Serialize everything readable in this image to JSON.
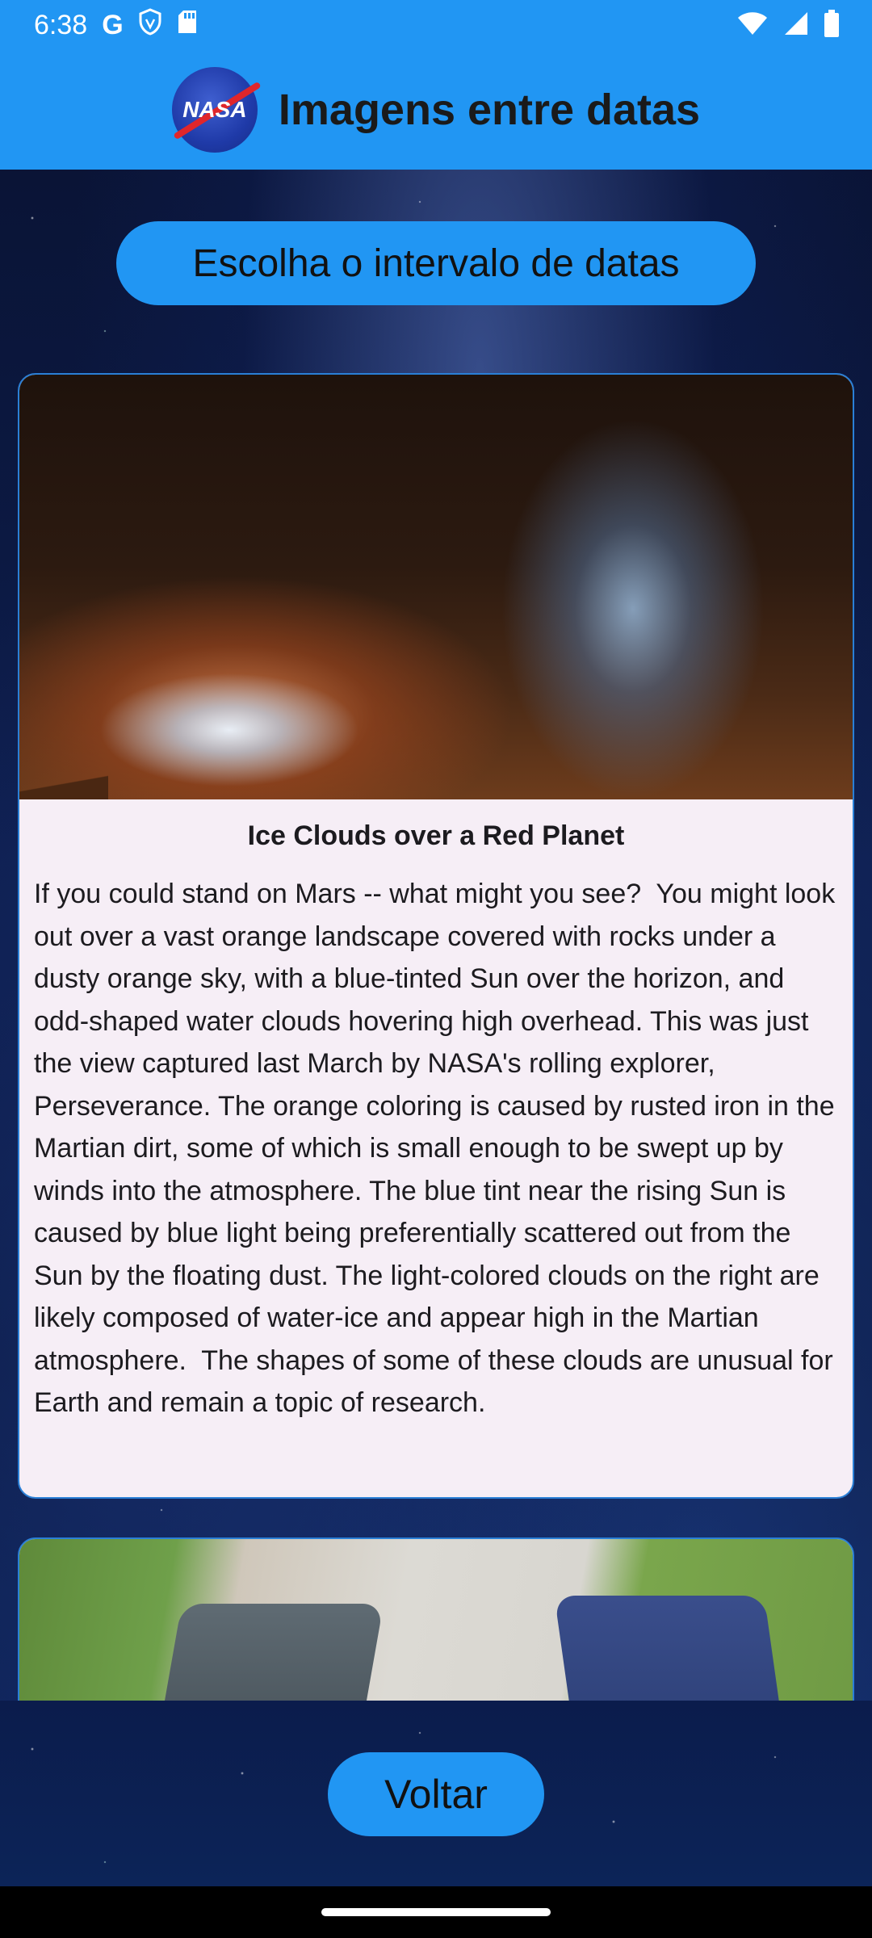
{
  "status_bar": {
    "time": "6:38",
    "left_icons": [
      "google-icon",
      "shield-icon",
      "sd-card-icon"
    ],
    "right_icons": [
      "wifi-icon",
      "signal-icon",
      "battery-icon"
    ]
  },
  "app_bar": {
    "logo_text": "NASA",
    "title": "Imagens entre datas"
  },
  "date_range_button": {
    "label": "Escolha o intervalo de datas"
  },
  "cards": [
    {
      "title": "Ice Clouds over a Red Planet",
      "text": "If you could stand on Mars -- what might you see?  You might look out over a vast orange landscape covered with rocks under a dusty orange sky, with a blue-tinted Sun over the horizon, and odd-shaped water clouds hovering high overhead. This was just the view captured last March by NASA's rolling explorer,  Perseverance. The orange coloring is caused by rusted iron in the Martian dirt, some of which is small enough to be swept up by winds into the atmosphere. The blue tint near the rising Sun is caused by blue light being preferentially scattered out from the Sun by the floating dust. The light-colored clouds on the right are likely composed of water-ice and appear high in the Martian atmosphere.  The shapes of some of these clouds are unusual for Earth and remain a topic of research."
    }
  ],
  "back_button": {
    "label": "Voltar"
  },
  "colors": {
    "primary": "#2196f3",
    "card_background": "#f6eef6",
    "card_border": "#2a7fd6",
    "text": "#1c1b1f"
  }
}
